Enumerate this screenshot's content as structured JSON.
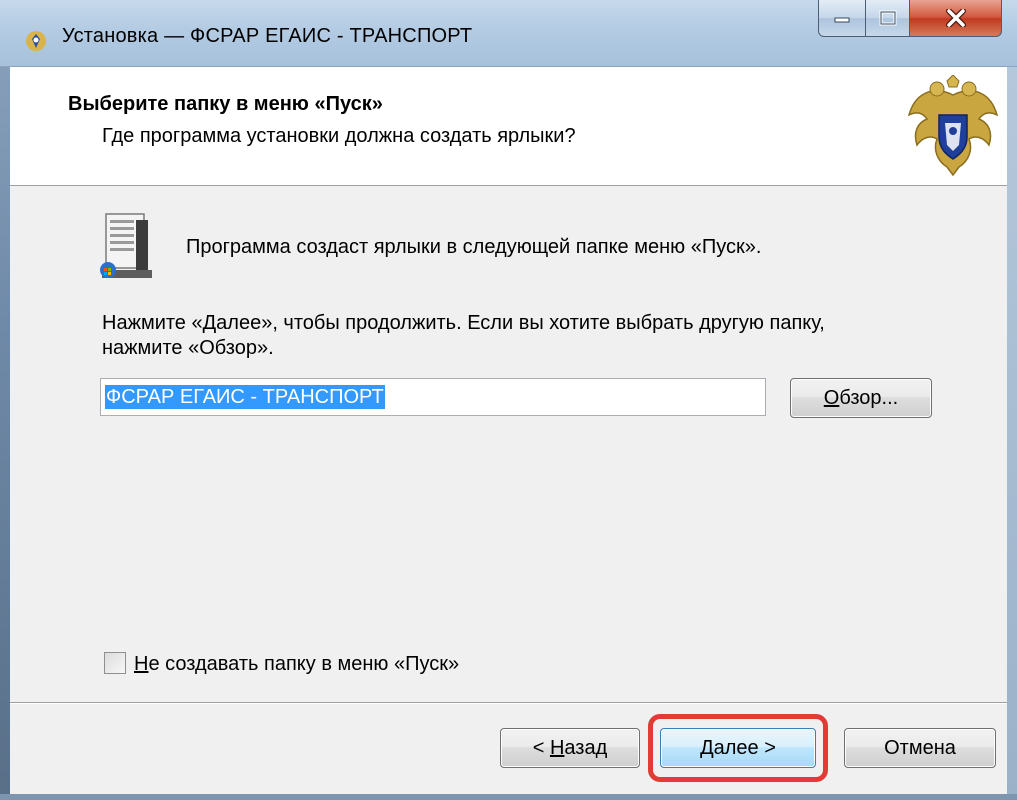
{
  "window": {
    "title": "Установка — ФСРАР ЕГАИС - ТРАНСПОРТ"
  },
  "header": {
    "title": "Выберите папку в меню «Пуск»",
    "subtitle": "Где программа установки должна создать ярлыки?"
  },
  "content": {
    "info_text": "Программа создаст ярлыки в следующей папке меню «Пуск».",
    "instruction_line1": "Нажмите «Далее», чтобы продолжить. Если вы хотите выбрать другую папку,",
    "instruction_line2": "нажмите «Обзор».",
    "folder_value": "ФСРАР ЕГАИС - ТРАНСПОРТ",
    "browse_hotkey": "О",
    "browse_rest": "бзор...",
    "checkbox_hotkey": "Н",
    "checkbox_rest": "е создавать папку в меню «Пуск»",
    "checkbox_checked": false
  },
  "footer": {
    "back_prefix": "< ",
    "back_hotkey": "Н",
    "back_rest": "азад",
    "next_hotkey": "Д",
    "next_rest": "алее >",
    "cancel_label": "Отмена"
  },
  "colors": {
    "highlight": "#e53935",
    "selection": "#3399ff"
  },
  "icons": {
    "title_icon": "emblem-icon",
    "header_logo": "double-headed-eagle-emblem-icon",
    "content_icon": "start-menu-folder-icon"
  }
}
